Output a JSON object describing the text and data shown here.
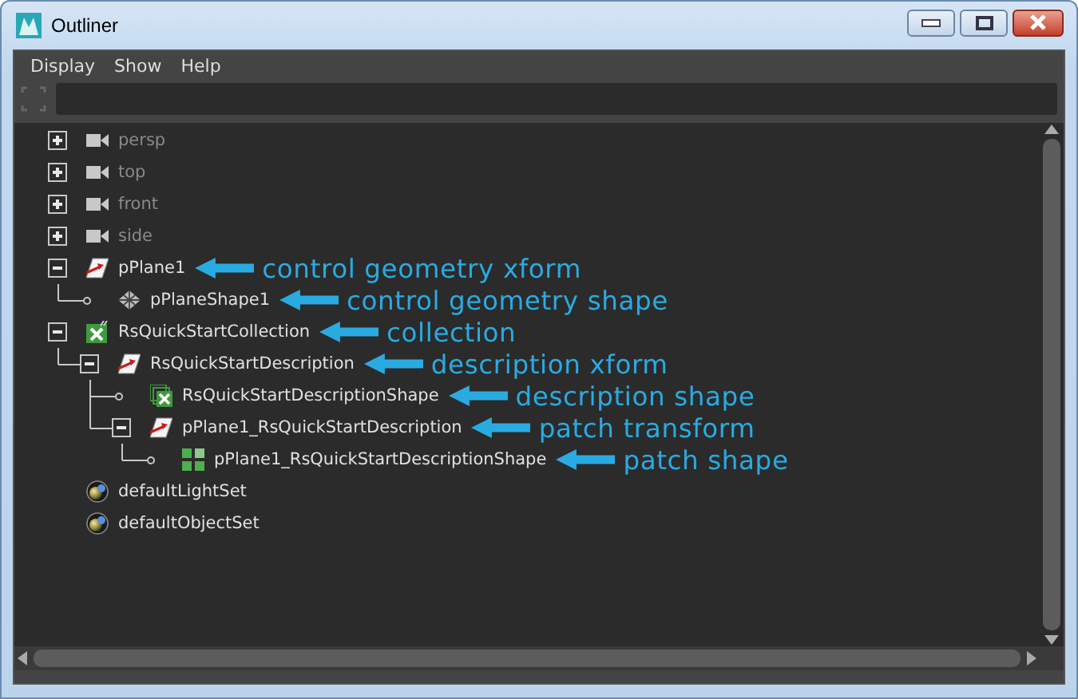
{
  "window": {
    "title": "Outliner"
  },
  "menu": [
    "Display",
    "Show",
    "Help"
  ],
  "tree": [
    {
      "label": "persp",
      "kind": "camera",
      "dimmed": true,
      "expanded": false
    },
    {
      "label": "top",
      "kind": "camera",
      "dimmed": true,
      "expanded": false
    },
    {
      "label": "front",
      "kind": "camera",
      "dimmed": true,
      "expanded": false
    },
    {
      "label": "side",
      "kind": "camera",
      "dimmed": true,
      "expanded": false
    },
    {
      "label": "pPlane1",
      "kind": "transform",
      "dimmed": false,
      "expanded": true,
      "note": "control geometry xform",
      "children": [
        {
          "label": "pPlaneShape1",
          "kind": "mesh",
          "dimmed": false,
          "note": "control geometry shape"
        }
      ]
    },
    {
      "label": "RsQuickStartCollection",
      "kind": "collection",
      "dimmed": false,
      "expanded": true,
      "note": "collection",
      "children": [
        {
          "label": "RsQuickStartDescription",
          "kind": "transform",
          "dimmed": false,
          "expanded": true,
          "note": "description xform",
          "children": [
            {
              "label": "RsQuickStartDescriptionShape",
              "kind": "shape",
              "dimmed": false,
              "note": "description shape"
            },
            {
              "label": "pPlane1_RsQuickStartDescription",
              "kind": "transform",
              "dimmed": false,
              "expanded": true,
              "note": "patch transform",
              "children": [
                {
                  "label": "pPlane1_RsQuickStartDescriptionShape",
                  "kind": "patch",
                  "dimmed": false,
                  "note": "patch shape"
                }
              ]
            }
          ]
        }
      ]
    },
    {
      "label": "defaultLightSet",
      "kind": "set",
      "dimmed": false
    },
    {
      "label": "defaultObjectSet",
      "kind": "set",
      "dimmed": false
    }
  ]
}
